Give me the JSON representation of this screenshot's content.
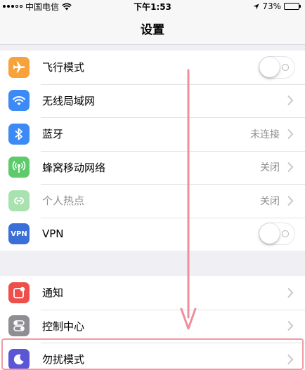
{
  "status_bar": {
    "carrier": "中国电信",
    "time": "下午1:53",
    "battery": "73%",
    "battery_level": 0.73
  },
  "nav": {
    "title": "设置"
  },
  "group1": [
    {
      "label": "飞行模式",
      "icon": "airplane-icon",
      "color": "#f7a23b",
      "control": "toggle",
      "on": false
    },
    {
      "label": "无线局域网",
      "icon": "wifi-icon",
      "color": "#3b8af6",
      "control": "chevron"
    },
    {
      "label": "蓝牙",
      "icon": "bluetooth-icon",
      "color": "#3b8af6",
      "value": "未连接",
      "control": "chevron"
    },
    {
      "label": "蜂窝移动网络",
      "icon": "cellular-icon",
      "color": "#5ecb6a",
      "value": "关闭",
      "control": "chevron"
    },
    {
      "label": "个人热点",
      "icon": "hotspot-icon",
      "color": "#a8e2ae",
      "value": "关闭",
      "control": "chevron",
      "disabled": true
    },
    {
      "label": "VPN",
      "icon": "vpn-icon",
      "icon_text": "VPN",
      "color": "#3b6fd8",
      "control": "toggle",
      "on": false
    }
  ],
  "group2": [
    {
      "label": "通知",
      "icon": "notifications-icon",
      "color": "#ee4f4a",
      "control": "chevron"
    },
    {
      "label": "控制中心",
      "icon": "control-center-icon",
      "color": "#8e8e93",
      "control": "chevron"
    },
    {
      "label": "勿扰模式",
      "icon": "moon-icon",
      "color": "#5b56d6",
      "control": "chevron"
    }
  ],
  "annotation": {
    "arrow_color": "#ef8f9b",
    "highlight_color": "#ef9aa4"
  }
}
